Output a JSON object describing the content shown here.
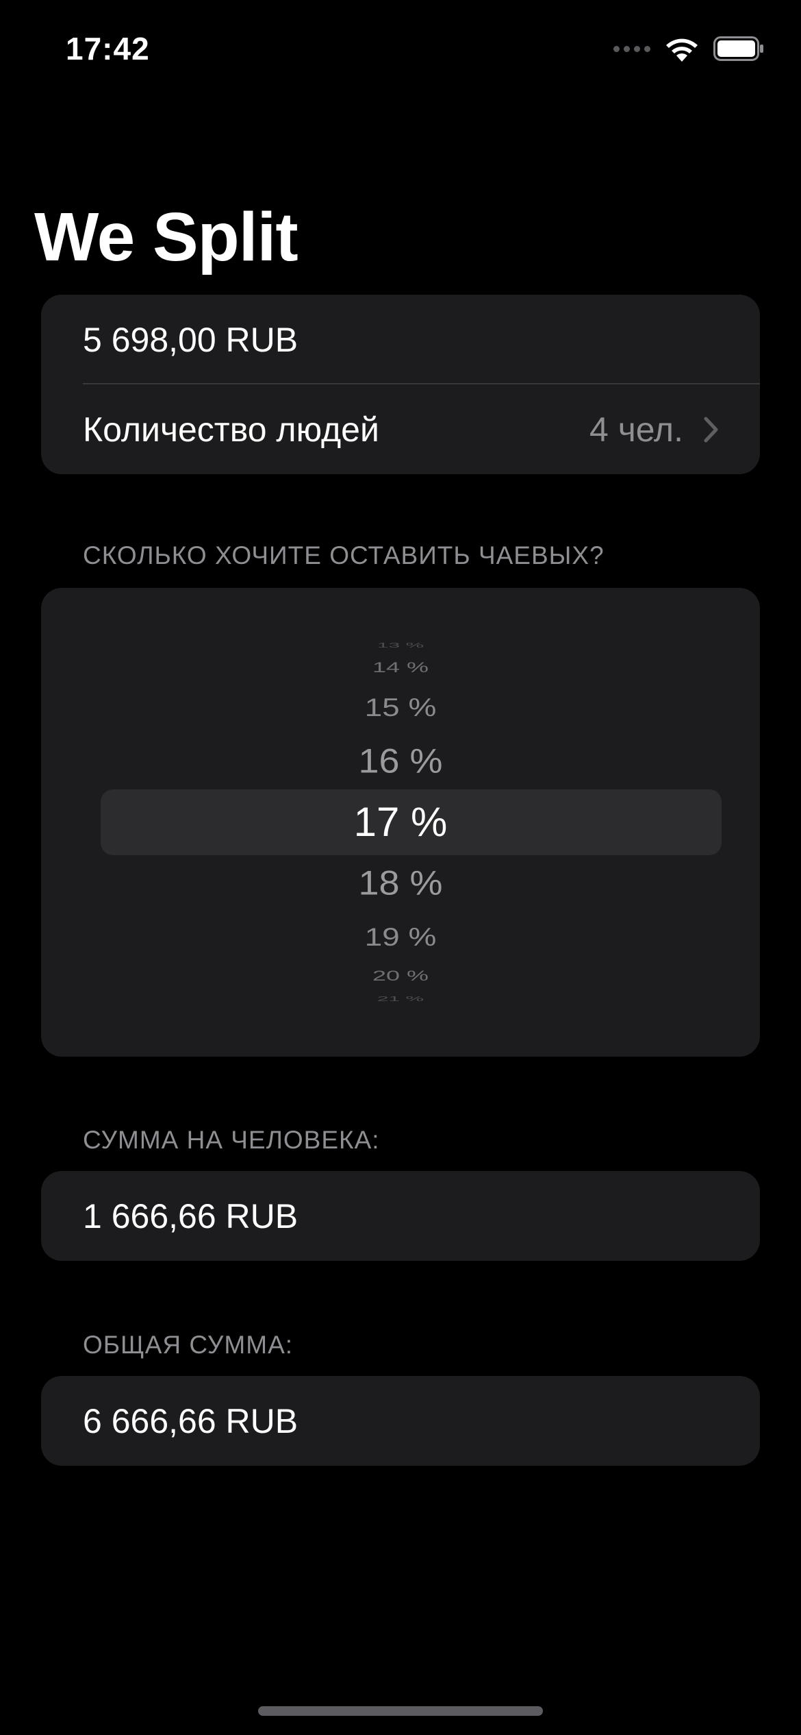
{
  "status_bar": {
    "time": "17:42"
  },
  "title": "We Split",
  "amount_card": {
    "amount": "5 698,00 RUB",
    "people_label": "Количество людей",
    "people_value": "4 чел."
  },
  "tip_section": {
    "header": "СКОЛЬКО ХОЧИТЕ ОСТАВИТЬ ЧАЕВЫХ?",
    "picker_items": [
      "13 %",
      "14 %",
      "15 %",
      "16 %",
      "17 %",
      "18 %",
      "19 %",
      "20 %",
      "21 %"
    ],
    "selected": "17 %"
  },
  "per_person": {
    "header": "СУММА НА ЧЕЛОВЕКА:",
    "value": "1 666,66 RUB"
  },
  "total": {
    "header": "ОБЩАЯ СУММА:",
    "value": "6 666,66 RUB"
  },
  "icons": {
    "signal": "cellular-signal-icon",
    "wifi": "wifi-icon",
    "battery": "battery-icon",
    "chevron": "chevron-right-icon"
  },
  "colors": {
    "background": "#000000",
    "card": "#1c1c1e",
    "secondary_text": "#8e8e93",
    "picker_highlight": "#2c2c2e"
  }
}
